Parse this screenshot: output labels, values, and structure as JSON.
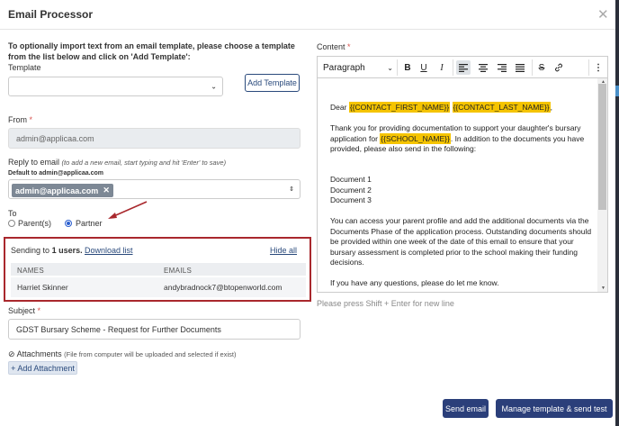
{
  "window": {
    "title": "Email Processor"
  },
  "template": {
    "instruction": "To optionally import text from an email template, please choose a template from the list below and click on 'Add Template':",
    "label": "Template",
    "selected": "",
    "add_button": "Add Template"
  },
  "from": {
    "label": "From",
    "required_mark": "*",
    "value": "admin@applicaa.com"
  },
  "reply": {
    "label": "Reply to email",
    "hint": "(to add a new email, start typing and hit 'Enter' to save)",
    "default_note": "Default to admin@applicaa.com",
    "chip": "admin@applicaa.com",
    "chip_remove": "✕"
  },
  "to": {
    "label": "To",
    "options": [
      {
        "label": "Parent(s)",
        "selected": false
      },
      {
        "label": "Partner",
        "selected": true
      }
    ]
  },
  "sending": {
    "prefix": "Sending to",
    "count": "1 users.",
    "download": "Download list",
    "hide": "Hide all",
    "columns": [
      "NAMES",
      "EMAILS"
    ],
    "rows": [
      {
        "name": "Harriet Skinner",
        "email": "andybradnock7@btopenworld.com"
      }
    ]
  },
  "subject": {
    "label": "Subject",
    "required_mark": "*",
    "value": "GDST Bursary Scheme - Request for Further Documents"
  },
  "attachments": {
    "label": "Attachments",
    "hint": "(File from computer will be uploaded and selected if exist)",
    "add_button": "+ Add Attachment"
  },
  "content": {
    "label": "Content",
    "required_mark": "*",
    "format_select": "Paragraph",
    "greeting": "Dear",
    "tag_first": "{{CONTACT_FIRST_NAME}}",
    "tag_last": "{{CONTACT_LAST_NAME}}",
    "greeting_end": ",",
    "p1_a": "Thank you for providing documentation to support your daughter's bursary application for",
    "tag_school": "{{SCHOOL_NAME}}",
    "p1_b": ". In addition to the documents you have provided, please also send in the following:",
    "docs": [
      "Document 1",
      "Document 2",
      "Document 3"
    ],
    "p2": "You can access your parent profile and add the additional documents via the Documents Phase of the application process. Outstanding documents should be provided within one week of the date of this email to ensure that your bursary assessment is completed prior to the school making their funding decisions.",
    "p3": "If you have any questions, please do let me know.",
    "hint": "Please press Shift + Enter for new line"
  },
  "footer": {
    "send": "Send email",
    "manage": "Manage template & send test"
  }
}
